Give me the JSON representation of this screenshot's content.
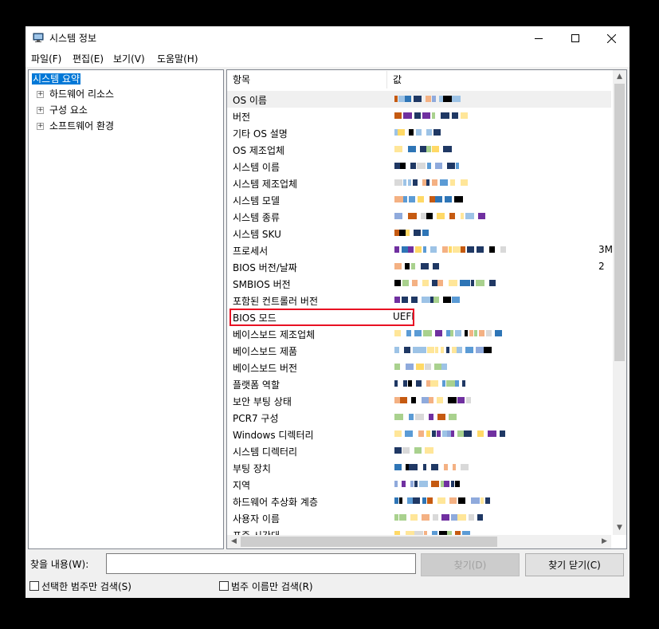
{
  "window": {
    "title": "시스템 정보"
  },
  "menu": [
    "파일(F)",
    "편집(E)",
    "보기(V)",
    "도움말(H)"
  ],
  "tree": {
    "selected": "시스템 요약",
    "children": [
      "하드웨어 리소스",
      "구성 요소",
      "소프트웨어 환경"
    ]
  },
  "list": {
    "headers": {
      "item": "항목",
      "value": "값"
    },
    "rows": [
      {
        "name": "OS 이름"
      },
      {
        "name": "버전"
      },
      {
        "name": "기타 OS 설명"
      },
      {
        "name": "OS 제조업체"
      },
      {
        "name": "시스템 이름"
      },
      {
        "name": "시스템 제조업체"
      },
      {
        "name": "시스템 모델"
      },
      {
        "name": "시스템 종류"
      },
      {
        "name": "시스템 SKU"
      },
      {
        "name": "프로세서",
        "value": "3M"
      },
      {
        "name": "BIOS 버전/날짜",
        "value": "2"
      },
      {
        "name": "SMBIOS 버전"
      },
      {
        "name": "포함된 컨트롤러 버전"
      },
      {
        "name": "BIOS 모드",
        "value": "UEFI"
      },
      {
        "name": "베이스보드 제조업체"
      },
      {
        "name": "베이스보드 제품"
      },
      {
        "name": "베이스보드 버전"
      },
      {
        "name": "플랫폼 역할"
      },
      {
        "name": "보안 부팅 상태"
      },
      {
        "name": "PCR7 구성"
      },
      {
        "name": "Windows 디렉터리"
      },
      {
        "name": "시스템 디렉터리"
      },
      {
        "name": "부팅 장치"
      },
      {
        "name": "지역"
      },
      {
        "name": "하드웨어 추상화 계층"
      },
      {
        "name": "사용자 이름"
      },
      {
        "name": "표준 시간대"
      }
    ]
  },
  "find": {
    "label": "찾을 내용(W):",
    "find_button": "찾기(D)",
    "close_button": "찾기 닫기(C)",
    "check_selected": "선택한 범주만 검색(S)",
    "check_names": "범주 이름만 검색(R)"
  },
  "colors": {
    "accent": "#0078d7",
    "highlight": "#e81123"
  }
}
